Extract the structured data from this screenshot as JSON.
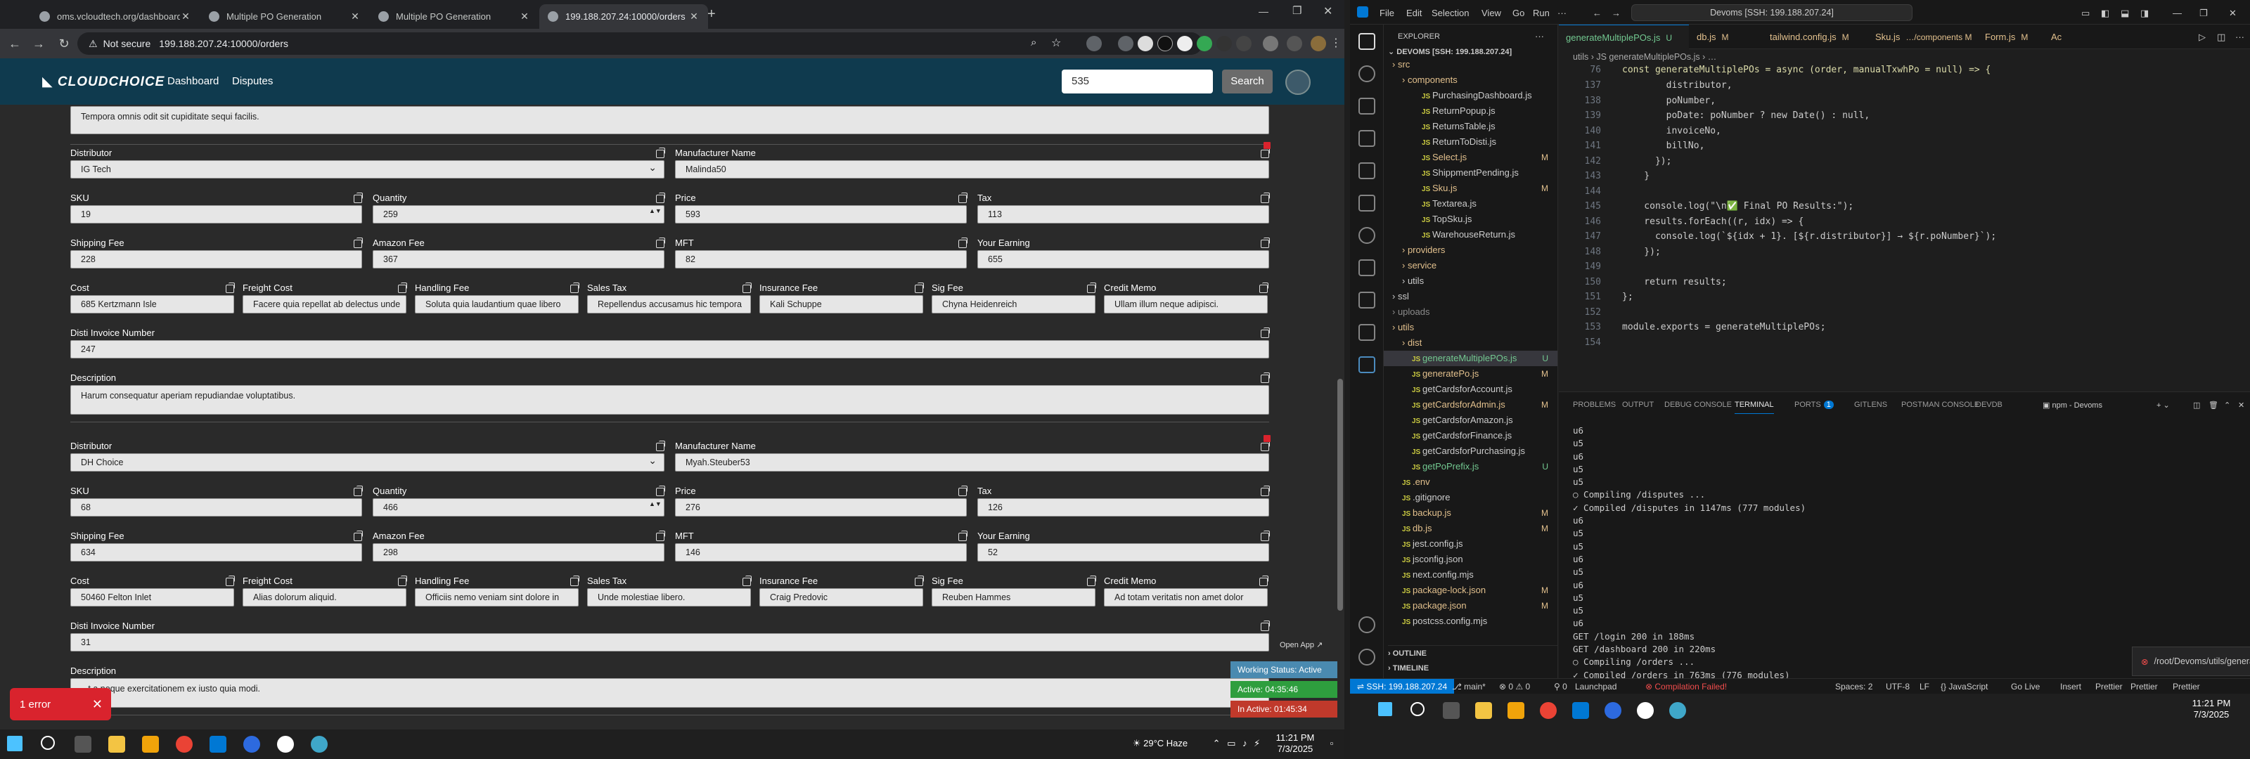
{
  "browser": {
    "tabs": [
      {
        "title": "oms.vcloudtech.org/dashboard"
      },
      {
        "title": "Multiple PO Generation"
      },
      {
        "title": "Multiple PO Generation"
      },
      {
        "title": "199.188.207.24:10000/orders"
      }
    ],
    "security": "Not secure",
    "url": "199.188.207.24:10000/orders"
  },
  "app": {
    "logo": "CLOUDCHOICE",
    "nav": [
      "Dashboard",
      "Disputes"
    ],
    "search_value": "535",
    "search_button": "Search"
  },
  "form": {
    "top_description": "Tempora omnis odit sit cupiditate sequi facilis.",
    "labels": {
      "distributor": "Distributor",
      "manufacturer": "Manufacturer Name",
      "sku": "SKU",
      "quantity": "Quantity",
      "price": "Price",
      "tax": "Tax",
      "shipping_fee": "Shipping Fee",
      "amazon_fee": "Amazon Fee",
      "mft": "MFT",
      "your_earning": "Your Earning",
      "cost": "Cost",
      "freight_cost": "Freight Cost",
      "handling_fee": "Handling Fee",
      "sales_tax": "Sales Tax",
      "insurance_fee": "Insurance Fee",
      "sig_fee": "Sig Fee",
      "credit_memo": "Credit Memo",
      "disti_invoice": "Disti Invoice Number",
      "description": "Description"
    },
    "blocks": [
      {
        "distributor": "IG Tech",
        "manufacturer": "Malinda50",
        "sku": "19",
        "quantity": "259",
        "price": "593",
        "tax": "113",
        "shipping_fee": "228",
        "amazon_fee": "367",
        "mft": "82",
        "your_earning": "655",
        "cost": "685 Kertzmann Isle",
        "freight_cost": "Facere quia repellat ab delectus unde",
        "handling_fee": "Soluta quia laudantium quae libero",
        "sales_tax": "Repellendus accusamus hic tempora",
        "insurance_fee": "Kali Schuppe",
        "sig_fee": "Chyna Heidenreich",
        "credit_memo": "Ullam illum neque adipisci.",
        "disti_invoice": "247",
        "description": "Harum consequatur aperiam repudiandae voluptatibus."
      },
      {
        "distributor": "DH Choice",
        "manufacturer": "Myah.Steuber53",
        "sku": "68",
        "quantity": "466",
        "price": "276",
        "tax": "126",
        "shipping_fee": "634",
        "amazon_fee": "298",
        "mft": "146",
        "your_earning": "52",
        "cost": "50460 Felton Inlet",
        "freight_cost": "Alias dolorum aliquid.",
        "handling_fee": "Officiis nemo veniam sint dolore in",
        "sales_tax": "Unde molestiae libero.",
        "insurance_fee": "Craig Predovic",
        "sig_fee": "Reuben Hammes",
        "credit_memo": "Ad totam veritatis non amet dolor",
        "disti_invoice": "31",
        "description": "...t a neque exercitationem ex iusto quia modi."
      }
    ]
  },
  "overlays": {
    "error": "1 error",
    "open_app": "Open App ↗",
    "working_status": "Working Status: Active",
    "active": "Active: 04:35:46",
    "inactive": "In Active: 01:45:34",
    "colors": {
      "error": "#d9232d",
      "working": "#4a8ab0",
      "active": "#2e9e3e",
      "inactive": "#c0392b"
    }
  },
  "vscode": {
    "menu": [
      "File",
      "Edit",
      "Selection",
      "View",
      "Go",
      "Run"
    ],
    "command_center": "Devoms [SSH: 199.188.207.24]",
    "explorer_title": "EXPLORER",
    "workspace": "DEVOMS [SSH: 199.188.207.24]",
    "tree": [
      {
        "name": "src",
        "indent": 0,
        "folder": true,
        "color": "#e2c08d"
      },
      {
        "name": "components",
        "indent": 1,
        "folder": true,
        "color": "#e2c08d"
      },
      {
        "name": "PurchasingDashboard.js",
        "indent": 2,
        "color": "#ccc"
      },
      {
        "name": "ReturnPopup.js",
        "indent": 2,
        "color": "#ccc"
      },
      {
        "name": "ReturnsTable.js",
        "indent": 2,
        "color": "#ccc"
      },
      {
        "name": "ReturnToDisti.js",
        "indent": 2,
        "color": "#ccc"
      },
      {
        "name": "Select.js",
        "indent": 2,
        "color": "#e2c08d",
        "mark": "M"
      },
      {
        "name": "ShippmentPending.js",
        "indent": 2,
        "color": "#ccc"
      },
      {
        "name": "Sku.js",
        "indent": 2,
        "color": "#e2c08d",
        "mark": "M"
      },
      {
        "name": "Textarea.js",
        "indent": 2,
        "color": "#ccc"
      },
      {
        "name": "TopSku.js",
        "indent": 2,
        "color": "#ccc"
      },
      {
        "name": "WarehouseReturn.js",
        "indent": 2,
        "color": "#ccc"
      },
      {
        "name": "providers",
        "indent": 1,
        "folder": true,
        "color": "#e2c08d"
      },
      {
        "name": "service",
        "indent": 1,
        "folder": true,
        "color": "#e2c08d"
      },
      {
        "name": "utils",
        "indent": 1,
        "folder": true,
        "color": "#ccc"
      },
      {
        "name": "ssl",
        "indent": 0,
        "folder": true,
        "color": "#ccc"
      },
      {
        "name": "uploads",
        "indent": 0,
        "folder": true,
        "color": "#8b8b8b"
      },
      {
        "name": "utils",
        "indent": 0,
        "folder": true,
        "color": "#e2c08d"
      },
      {
        "name": "dist",
        "indent": 1,
        "folder": true,
        "color": "#e2c08d"
      },
      {
        "name": "generateMultiplePOs.js",
        "indent": 1,
        "color": "#73c991",
        "mark": "U",
        "selected": true
      },
      {
        "name": "generatePo.js",
        "indent": 1,
        "color": "#e2c08d",
        "mark": "M"
      },
      {
        "name": "getCardsforAccount.js",
        "indent": 1,
        "color": "#ccc"
      },
      {
        "name": "getCardsforAdmin.js",
        "indent": 1,
        "color": "#e2c08d",
        "mark": "M"
      },
      {
        "name": "getCardsforAmazon.js",
        "indent": 1,
        "color": "#ccc"
      },
      {
        "name": "getCardsforFinance.js",
        "indent": 1,
        "color": "#ccc"
      },
      {
        "name": "getCardsforPurchasing.js",
        "indent": 1,
        "color": "#ccc"
      },
      {
        "name": "getPoPrefix.js",
        "indent": 1,
        "color": "#73c991",
        "mark": "U"
      },
      {
        "name": ".env",
        "indent": 0,
        "color": "#e2c08d"
      },
      {
        "name": ".gitignore",
        "indent": 0,
        "color": "#ccc"
      },
      {
        "name": "backup.js",
        "indent": 0,
        "color": "#e2c08d",
        "mark": "M"
      },
      {
        "name": "db.js",
        "indent": 0,
        "color": "#e2c08d",
        "mark": "M"
      },
      {
        "name": "jest.config.js",
        "indent": 0,
        "color": "#ccc"
      },
      {
        "name": "jsconfig.json",
        "indent": 0,
        "color": "#ccc"
      },
      {
        "name": "next.config.mjs",
        "indent": 0,
        "color": "#ccc"
      },
      {
        "name": "package-lock.json",
        "indent": 0,
        "color": "#e2c08d",
        "mark": "M"
      },
      {
        "name": "package.json",
        "indent": 0,
        "color": "#e2c08d",
        "mark": "M"
      },
      {
        "name": "postcss.config.mjs",
        "indent": 0,
        "color": "#ccc"
      }
    ],
    "outline": "OUTLINE",
    "timeline": "TIMELINE",
    "editor_tabs": [
      {
        "name": "generateMultiplePOs.js",
        "mark": "U",
        "active": true
      },
      {
        "name": "db.js",
        "mark": "M"
      },
      {
        "name": "tailwind.config.js",
        "mark": "M"
      },
      {
        "name": "Sku.js",
        "mark": "…/components M"
      },
      {
        "name": "Form.js",
        "mark": "M"
      },
      {
        "name": "Ac",
        "mark": ""
      }
    ],
    "breadcrumb": "utils › JS generateMultiplePOs.js › …",
    "sticky_line": {
      "num": "76",
      "text": "const generateMultiplePOs = async (order, manualTxwhPo = null) => {"
    },
    "code_lines": [
      {
        "num": "137",
        "html": "        distributor,"
      },
      {
        "num": "138",
        "html": "        poNumber,"
      },
      {
        "num": "139",
        "html": "        poDate: poNumber ? new Date() : null,"
      },
      {
        "num": "140",
        "html": "        invoiceNo,"
      },
      {
        "num": "141",
        "html": "        billNo,"
      },
      {
        "num": "142",
        "html": "      });"
      },
      {
        "num": "143",
        "html": "    }"
      },
      {
        "num": "144",
        "html": ""
      },
      {
        "num": "145",
        "html": "    console.log(\"\\n✅ Final PO Results:\");"
      },
      {
        "num": "146",
        "html": "    results.forEach((r, idx) => {"
      },
      {
        "num": "147",
        "html": "      console.log(`${idx + 1}. [${r.distributor}] → ${r.poNumber}`);"
      },
      {
        "num": "148",
        "html": "    });"
      },
      {
        "num": "149",
        "html": ""
      },
      {
        "num": "150",
        "html": "    return results;"
      },
      {
        "num": "151",
        "html": "};"
      },
      {
        "num": "152",
        "html": ""
      },
      {
        "num": "153",
        "html": "module.exports = generateMultiplePOs;"
      },
      {
        "num": "154",
        "html": ""
      }
    ],
    "panel_tabs": [
      "PROBLEMS",
      "OUTPUT",
      "DEBUG CONSOLE",
      "TERMINAL",
      "PORTS",
      "GITLENS",
      "POSTMAN CONSOLE",
      "DEVDB"
    ],
    "ports_count": "1",
    "terminal_name": "npm - Devoms",
    "terminal_lines": [
      "u6",
      "u5",
      "u6",
      "u5",
      "u5",
      "○ Compiling /disputes ...",
      "✓ Compiled /disputes in 1147ms (777 modules)",
      "u6",
      "u5",
      "u5",
      "u6",
      "u5",
      "u6",
      "u5",
      "u5",
      "u6",
      "GET /login 200 in 188ms",
      "GET /dashboard 200 in 220ms",
      "○ Compiling /orders ...",
      "✓ Compiled /orders in 763ms (776 modules)"
    ],
    "toast": "/root/Devoms/utils/generateMultiplePOs.js: Support for the experime...",
    "status": {
      "remote": "SSH: 199.188.207.24",
      "branch": "main*",
      "problems": "⊗ 0 ⚠ 0",
      "ports": "0",
      "launchpad": "Launchpad",
      "compile": "Compilation Failed!",
      "right": [
        "Spaces: 2",
        "UTF-8",
        "LF",
        "{} JavaScript",
        "Go Live",
        "Insert",
        "Prettier",
        "Prettier",
        "Prettier"
      ]
    }
  },
  "taskbar": {
    "weather": "29°C  Haze",
    "time_left": "11:21 PM",
    "date_left": "7/3/2025",
    "time_right": "11:21 PM",
    "date_right": "7/3/2025"
  }
}
